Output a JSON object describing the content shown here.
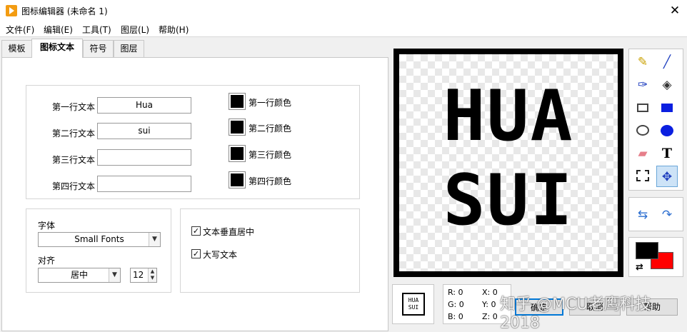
{
  "title": "图标编辑器 (未命名 1)",
  "menu": [
    "文件(F)",
    "编辑(E)",
    "工具(T)",
    "图层(L)",
    "帮助(H)"
  ],
  "tabs": [
    "模板",
    "图标文本",
    "符号",
    "图层"
  ],
  "lines": [
    {
      "label": "第一行文本",
      "value": "Hua",
      "color_label": "第一行颜色"
    },
    {
      "label": "第二行文本",
      "value": "sui",
      "color_label": "第二行颜色"
    },
    {
      "label": "第三行文本",
      "value": "",
      "color_label": "第三行颜色"
    },
    {
      "label": "第四行文本",
      "value": "",
      "color_label": "第四行颜色"
    }
  ],
  "font": {
    "label": "字体",
    "value": "Small Fonts"
  },
  "align": {
    "label": "对齐",
    "value": "居中",
    "size": "12"
  },
  "options": [
    {
      "label": "文本垂直居中",
      "checked": true
    },
    {
      "label": "大写文本",
      "checked": true
    }
  ],
  "canvas": {
    "line1": "HUA",
    "line2": "SUI"
  },
  "preview": {
    "line1": "HUA",
    "line2": "SUI"
  },
  "readout": {
    "r": "R: 0",
    "g": "G: 0",
    "b": "B: 0",
    "x": "X: 0",
    "y": "Y: 0",
    "z": "Z: 0"
  },
  "buttons": {
    "ok": "确定",
    "cancel": "取消",
    "help": "帮助"
  },
  "watermark": "知乎 @MCU老鹰科技2018",
  "colors": {
    "foreground": "#000000",
    "background": "#ff0000",
    "selection": "#cde3f7"
  }
}
